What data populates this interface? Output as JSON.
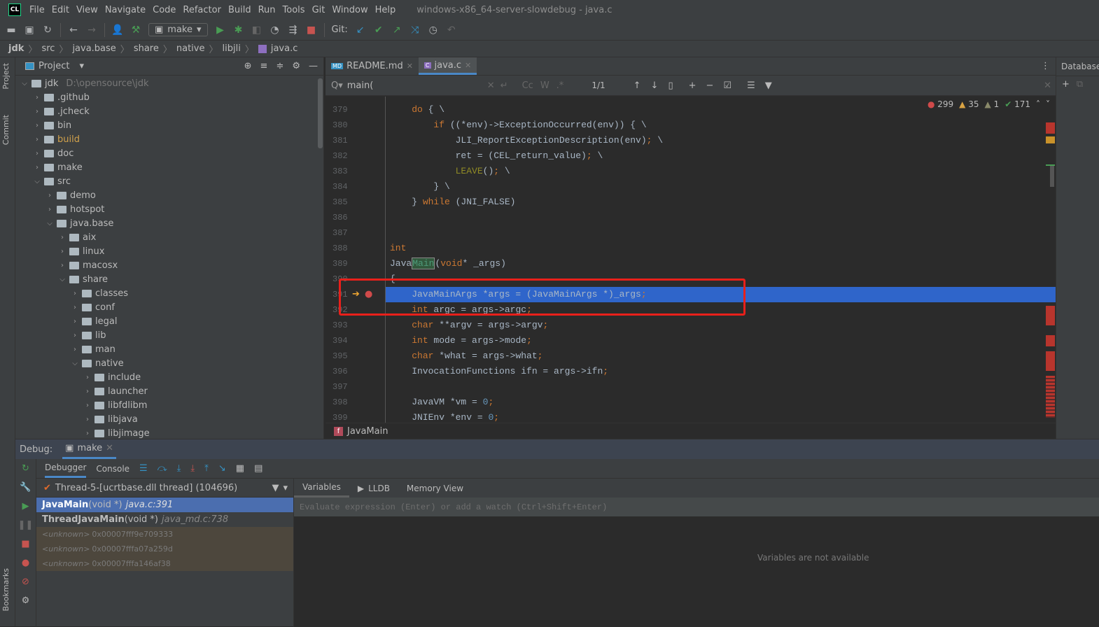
{
  "app": {
    "logo": "CL",
    "title": "windows-x86_64-server-slowdebug - java.c"
  },
  "menu": [
    "File",
    "Edit",
    "View",
    "Navigate",
    "Code",
    "Refactor",
    "Build",
    "Run",
    "Tools",
    "Git",
    "Window",
    "Help"
  ],
  "toolbar": {
    "run_config": "make",
    "git_label": "Git:"
  },
  "breadcrumb": [
    "jdk",
    "src",
    "java.base",
    "share",
    "native",
    "libjli",
    "java.c"
  ],
  "stripe": {
    "project": "Project",
    "commit": "Commit",
    "bookmarks": "Bookmarks"
  },
  "project": {
    "title": "Project",
    "tree": [
      {
        "name": "jdk",
        "path": "D:\\opensource\\jdk",
        "depth": 0,
        "open": true
      },
      {
        "name": ".github",
        "depth": 1
      },
      {
        "name": ".jcheck",
        "depth": 1
      },
      {
        "name": "bin",
        "depth": 1
      },
      {
        "name": "build",
        "depth": 1,
        "color": "#d0a14b"
      },
      {
        "name": "doc",
        "depth": 1
      },
      {
        "name": "make",
        "depth": 1
      },
      {
        "name": "src",
        "depth": 1,
        "open": true
      },
      {
        "name": "demo",
        "depth": 2
      },
      {
        "name": "hotspot",
        "depth": 2
      },
      {
        "name": "java.base",
        "depth": 2,
        "open": true
      },
      {
        "name": "aix",
        "depth": 3
      },
      {
        "name": "linux",
        "depth": 3
      },
      {
        "name": "macosx",
        "depth": 3
      },
      {
        "name": "share",
        "depth": 3,
        "open": true
      },
      {
        "name": "classes",
        "depth": 4
      },
      {
        "name": "conf",
        "depth": 4
      },
      {
        "name": "legal",
        "depth": 4
      },
      {
        "name": "lib",
        "depth": 4
      },
      {
        "name": "man",
        "depth": 4
      },
      {
        "name": "native",
        "depth": 4,
        "open": true
      },
      {
        "name": "include",
        "depth": 5
      },
      {
        "name": "launcher",
        "depth": 5
      },
      {
        "name": "libfdlibm",
        "depth": 5
      },
      {
        "name": "libjava",
        "depth": 5
      },
      {
        "name": "libjimage",
        "depth": 5
      }
    ]
  },
  "editor": {
    "tabs": [
      {
        "label": "README.md",
        "badge": "MD",
        "active": false
      },
      {
        "label": "java.c",
        "badge": "C",
        "active": true
      }
    ],
    "search": {
      "query": "main(",
      "matches": "1/1",
      "cc": "Cc",
      "w": "W",
      "re": ".*"
    },
    "inspections": {
      "errors": "299",
      "warnings": "35",
      "weak": "1",
      "ok": "171"
    },
    "current_line": 391,
    "lines": [
      {
        "n": "379",
        "t": [
          [
            "    "
          ],
          [
            "do",
            "kw"
          ],
          [
            " { \\"
          ]
        ]
      },
      {
        "n": "380",
        "t": [
          [
            "        "
          ],
          [
            "if",
            "kw"
          ],
          [
            " ((*env)->ExceptionOccurred(env)) { \\"
          ]
        ]
      },
      {
        "n": "381",
        "t": [
          [
            "            JLI_ReportExceptionDescription(env)"
          ],
          [
            ";",
            "semi"
          ],
          [
            " \\"
          ]
        ]
      },
      {
        "n": "382",
        "t": [
          [
            "            ret = (CEL_return_value)"
          ],
          [
            ";",
            "semi"
          ],
          [
            " \\"
          ]
        ]
      },
      {
        "n": "383",
        "t": [
          [
            "            "
          ],
          [
            "LEAVE",
            "mac"
          ],
          [
            "()"
          ],
          [
            ";",
            "semi"
          ],
          [
            " \\"
          ]
        ]
      },
      {
        "n": "384",
        "t": [
          [
            "        } \\"
          ]
        ]
      },
      {
        "n": "385",
        "t": [
          [
            "    } "
          ],
          [
            "while",
            "kw"
          ],
          [
            " (JNI_FALSE)"
          ]
        ]
      },
      {
        "n": "386",
        "t": []
      },
      {
        "n": "387",
        "t": []
      },
      {
        "n": "388",
        "t": [
          [
            "int",
            "kw"
          ]
        ]
      },
      {
        "n": "389",
        "t": [
          [
            "Java"
          ],
          [
            "Main",
            "hl"
          ],
          [
            "("
          ],
          [
            "void",
            "kw"
          ],
          [
            "* _args)"
          ]
        ]
      },
      {
        "n": "390",
        "t": [
          [
            "{"
          ]
        ]
      },
      {
        "n": "391",
        "t": [
          [
            "    JavaMainArgs *args = (JavaMainArgs *)_args"
          ],
          [
            ";",
            "semi"
          ]
        ]
      },
      {
        "n": "392",
        "t": [
          [
            "    "
          ],
          [
            "int",
            "kw"
          ],
          [
            " argc = args->argc"
          ],
          [
            ";",
            "semi"
          ]
        ]
      },
      {
        "n": "393",
        "t": [
          [
            "    "
          ],
          [
            "char",
            "kw"
          ],
          [
            " **argv = args->argv"
          ],
          [
            ";",
            "semi"
          ]
        ]
      },
      {
        "n": "394",
        "t": [
          [
            "    "
          ],
          [
            "int",
            "kw"
          ],
          [
            " mode = args->mode"
          ],
          [
            ";",
            "semi"
          ]
        ]
      },
      {
        "n": "395",
        "t": [
          [
            "    "
          ],
          [
            "char",
            "kw"
          ],
          [
            " *what = args->what"
          ],
          [
            ";",
            "semi"
          ]
        ]
      },
      {
        "n": "396",
        "t": [
          [
            "    InvocationFunctions ifn = args->ifn"
          ],
          [
            ";",
            "semi"
          ]
        ]
      },
      {
        "n": "397",
        "t": []
      },
      {
        "n": "398",
        "t": [
          [
            "    JavaVM *vm = "
          ],
          [
            "0",
            "num"
          ],
          [
            ";",
            "semi"
          ]
        ]
      },
      {
        "n": "399",
        "t": [
          [
            "    JNIEnv *env = "
          ],
          [
            "0",
            "num"
          ],
          [
            ";",
            "semi"
          ]
        ]
      }
    ],
    "nav_function": "JavaMain"
  },
  "database": {
    "title": "Database"
  },
  "debug": {
    "label": "Debug:",
    "session": "make",
    "tabs": [
      "Debugger",
      "Console"
    ],
    "thread": "Thread-5-[ucrtbase.dll thread] (104696)",
    "frames": [
      {
        "fn": "JavaMain",
        "sig": "(void *)",
        "loc": "java.c:391",
        "selected": true
      },
      {
        "fn": "ThreadJavaMain",
        "sig": "(void *)",
        "loc": "java_md.c:738"
      },
      {
        "fn": "<unknown>",
        "addr": "0x00007fff9e709333"
      },
      {
        "fn": "<unknown>",
        "addr": "0x00007fffa07a259d"
      },
      {
        "fn": "<unknown>",
        "addr": "0x00007fffa146af38"
      }
    ],
    "var_tabs": [
      "Variables",
      "LLDB",
      "Memory View"
    ],
    "eval_placeholder": "Evaluate expression (Enter) or add a watch (Ctrl+Shift+Enter)",
    "empty_message": "Variables are not available"
  },
  "colors": {
    "accent": "#2f65ca",
    "annotation": "#e8201b",
    "run": "#499c54",
    "stop": "#c75450"
  }
}
